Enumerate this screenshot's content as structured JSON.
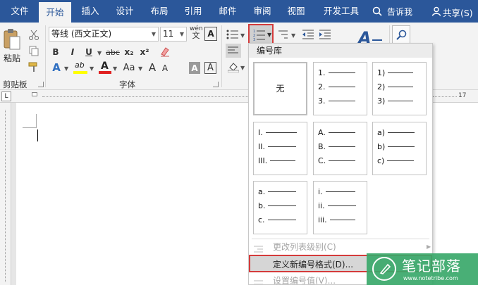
{
  "tabs": [
    "文件",
    "开始",
    "插入",
    "设计",
    "布局",
    "引用",
    "邮件",
    "审阅",
    "视图",
    "开发工具"
  ],
  "tell_me": "告诉我",
  "share": "共享(S)",
  "clipboard": {
    "paste": "粘贴",
    "group_label": "剪贴板"
  },
  "font": {
    "name": "等线 (西文正文)",
    "size": "11",
    "group_label": "字体",
    "phonetic": "wén",
    "bold": "B",
    "italic": "I",
    "underline": "U",
    "strike": "abc",
    "sub": "x₂",
    "sup": "x²",
    "text_effects": "A",
    "highlight": "ab",
    "font_color": "A",
    "case": "Aa",
    "grow": "A",
    "shrink": "A",
    "char_shade": "A",
    "char_border": "A",
    "border_char": "A"
  },
  "ruler_marks": [
    "17"
  ],
  "dropdown": {
    "header": "编号库",
    "none_label": "无",
    "tiles": [
      [
        "1.",
        "2.",
        "3."
      ],
      [
        "1)",
        "2)",
        "3)"
      ],
      [
        "I.",
        "II.",
        "III."
      ],
      [
        "A.",
        "B.",
        "C."
      ],
      [
        "a)",
        "b)",
        "c)"
      ],
      [
        "a.",
        "b.",
        "c."
      ],
      [
        "i.",
        "ii.",
        "iii."
      ]
    ],
    "change_level": "更改列表级别(C)",
    "define_new": "定义新编号格式(D)...",
    "set_value": "设置编号值(V)..."
  },
  "watermark": {
    "title": "笔记部落",
    "url": "www.notetribe.com"
  },
  "colors": {
    "accent": "#2b579a",
    "highlight_red": "#d43b3b",
    "watermark_green": "#3aa86a"
  }
}
